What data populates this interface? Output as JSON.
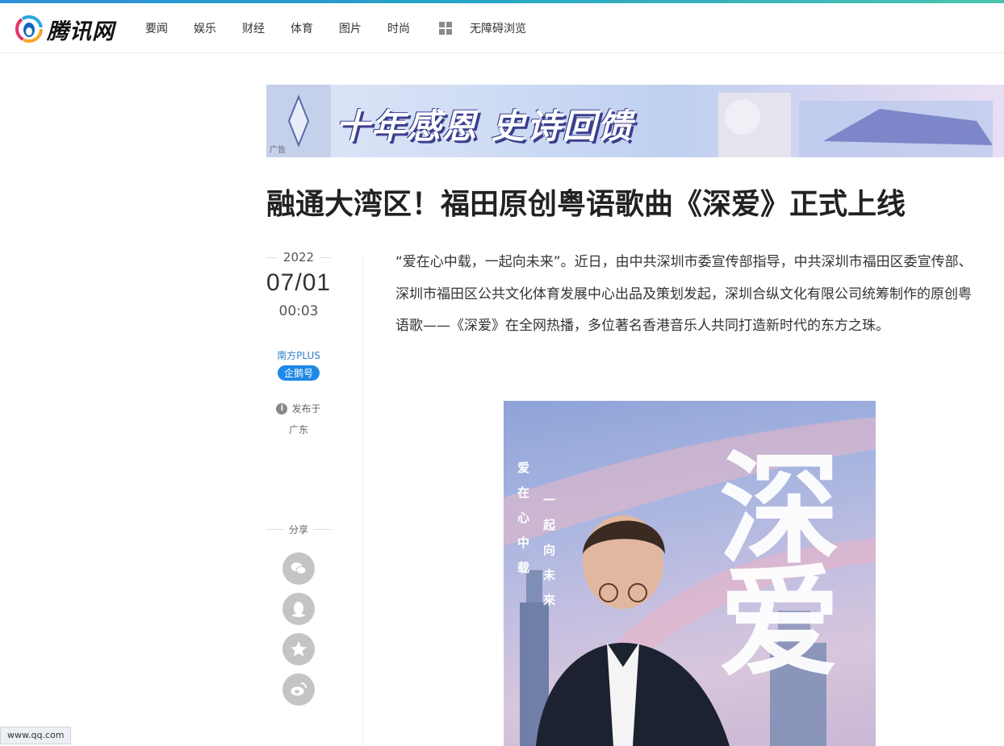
{
  "brand": {
    "name": "腾讯网"
  },
  "nav": {
    "items": [
      "要闻",
      "娱乐",
      "财经",
      "体育",
      "图片",
      "时尚"
    ],
    "accessible_label": "无障碍浏览"
  },
  "banner": {
    "text": "十年感恩 史诗回馈",
    "ad_label": "广告"
  },
  "article": {
    "title": "融通大湾区！福田原创粤语歌曲《深爱》正式上线",
    "year": "2022",
    "date": "07/01",
    "time": "00:03",
    "source": "南方PLUS",
    "source_badge": "企鹅号",
    "published_label": "发布于",
    "published_region": "广东",
    "share_label": "分享",
    "body": "“爱在心中载，一起向未来”。近日，由中共深圳市委宣传部指导，中共深圳市福田区委宣传部、深圳市福田区公共文化体育发展中心出品及策划发起，深圳合纵文化有限公司统筹制作的原创粤语歌——《深爱》在全网热播，多位著名香港音乐人共同打造新时代的东方之珠。"
  },
  "hero_image": {
    "vertical_text_left": "爱在心中载",
    "vertical_text_right": "一起向未來",
    "big_title": "深爱"
  },
  "share_icons": [
    "wechat-icon",
    "qq-icon",
    "qzone-icon",
    "weibo-icon"
  ],
  "status_bar": {
    "url": "www.qq.com"
  },
  "colors": {
    "accent": "#1e88e5",
    "source_link": "#2f82c7",
    "share_icon_bg": "#c4c4c4"
  }
}
